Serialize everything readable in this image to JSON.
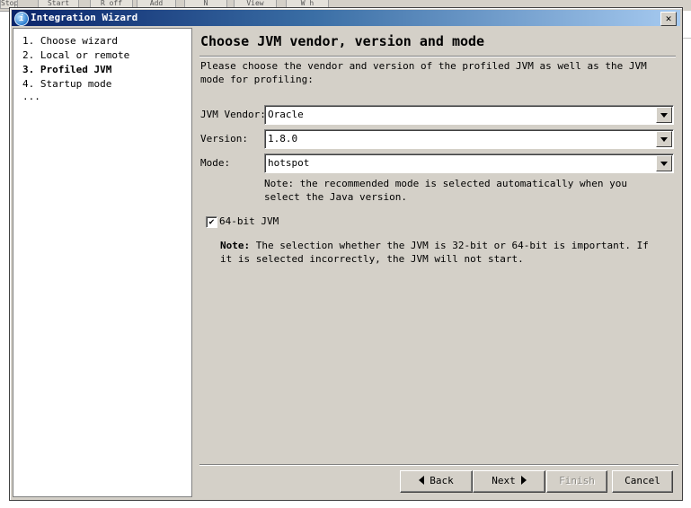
{
  "background": {
    "toolbar_labels": [
      "Stop",
      "Start",
      "R off",
      "Add",
      "N",
      "View",
      "W h"
    ]
  },
  "window": {
    "title": "Integration Wizard",
    "close_label": "✕"
  },
  "steps": [
    {
      "label": "1. Choose wizard",
      "active": false
    },
    {
      "label": "2. Local or remote",
      "active": false
    },
    {
      "label": "3. Profiled JVM",
      "active": true
    },
    {
      "label": "4. Startup mode",
      "active": false
    },
    {
      "label": "...",
      "active": false
    }
  ],
  "content": {
    "heading": "Choose JVM vendor, version and mode",
    "intro": "Please choose the vendor and version of the profiled JVM as well as the JVM mode for profiling:",
    "vendor": {
      "label": "JVM Vendor:",
      "value": "Oracle"
    },
    "version": {
      "label": "Version:",
      "value": "1.8.0"
    },
    "mode": {
      "label": "Mode:",
      "value": "hotspot"
    },
    "mode_note": "Note: the recommended mode is selected automatically when you select the Java version.",
    "bits_checkbox": {
      "label": "64-bit JVM",
      "checked": true,
      "mark": "✔"
    },
    "bits_note_prefix": "Note:",
    "bits_note_text": " The selection whether the JVM is 32-bit or 64-bit is important. If it is selected incorrectly, the JVM will not start."
  },
  "buttons": {
    "back": "Back",
    "next": "Next",
    "finish": "Finish",
    "cancel": "Cancel"
  }
}
